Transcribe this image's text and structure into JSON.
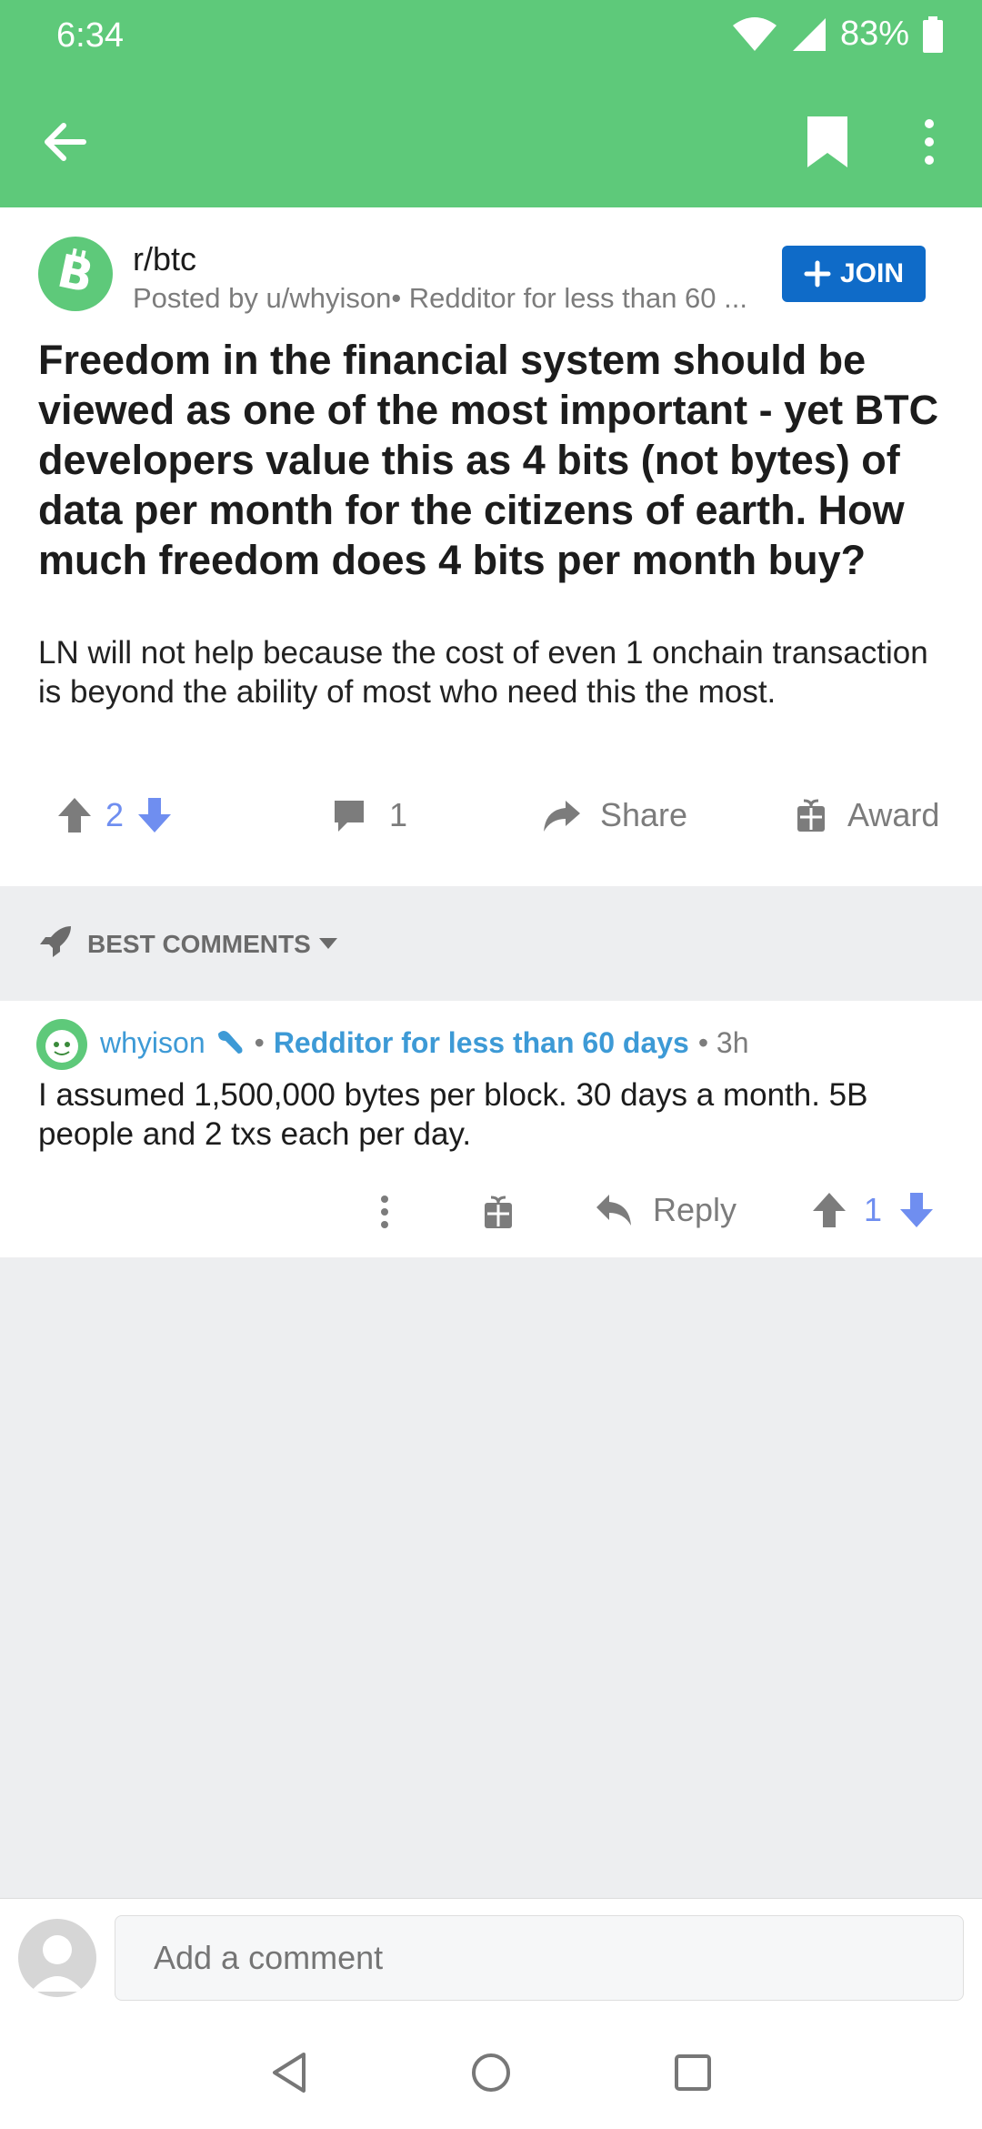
{
  "status": {
    "time": "6:34",
    "battery": "83%"
  },
  "appbar": {
    "back_icon": "arrow-left-icon",
    "bookmark_icon": "bookmark-icon",
    "menu_icon": "more-vertical-icon"
  },
  "post": {
    "subreddit": "r/btc",
    "posted_by": "Posted by u/whyison• Redditor for less than 60 ...",
    "join_label": "JOIN",
    "title": "Freedom in the financial system should be viewed as one of the most important - yet BTC developers value this as 4 bits (not bytes) of data per month for the citizens of earth. How much freedom does 4 bits per month buy?",
    "body": "LN will not help because the cost of even 1 onchain transaction is beyond the ability of most who need this the most.",
    "score": "2",
    "comment_count": "1",
    "share_label": "Share",
    "award_label": "Award"
  },
  "sort": {
    "label": "BEST COMMENTS"
  },
  "comment": {
    "user": "whyison",
    "separator": "•",
    "flair": "Redditor for less than 60 days",
    "time": "• 3h",
    "body": "I assumed 1,500,000 bytes per block.  30 days a month.  5B people and 2 txs each per day.",
    "reply_label": "Reply",
    "score": "1"
  },
  "composer": {
    "placeholder": "Add a comment"
  },
  "colors": {
    "brand": "#5ec97a",
    "join": "#0f6bc8",
    "vote": "#6f8ef0",
    "flair": "#3d9ad6"
  }
}
